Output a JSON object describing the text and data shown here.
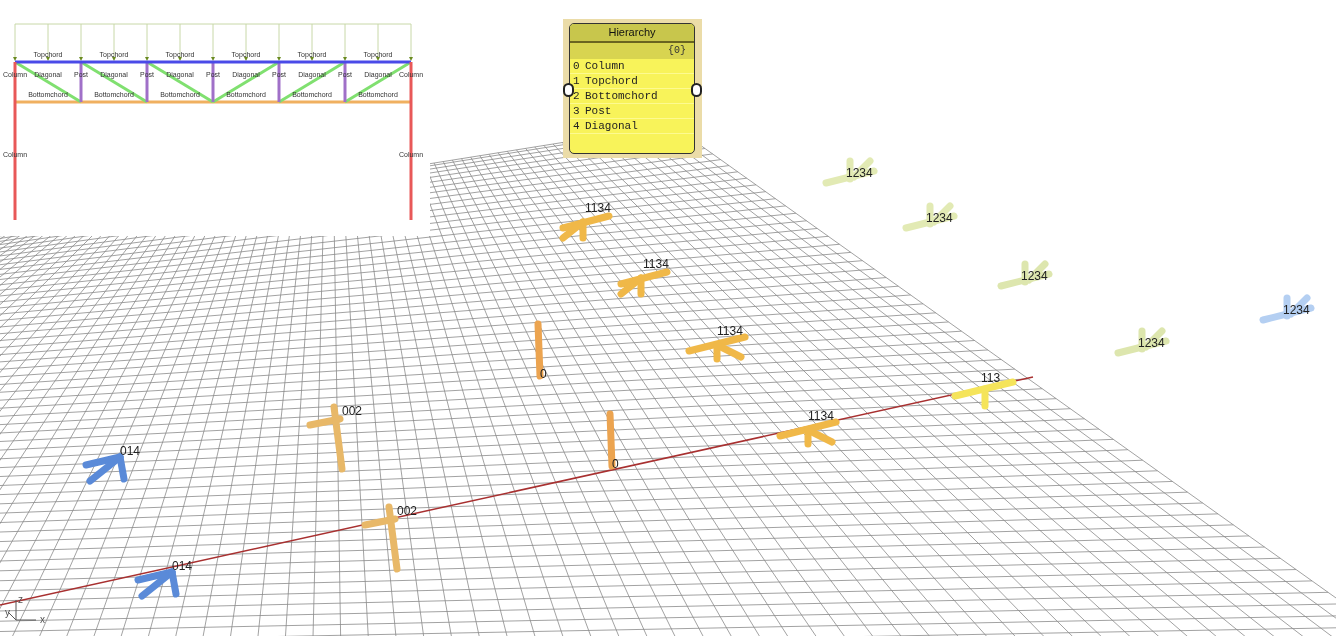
{
  "truss_diagram": {
    "bays": [
      {
        "top_label": "Topchord",
        "diagonal_label": "Diagonal",
        "bottom_label": "Bottomchord",
        "kind": "falling"
      },
      {
        "top_label": "Topchord",
        "diagonal_label": "Diagonal",
        "bottom_label": "Bottomchord",
        "kind": "falling"
      },
      {
        "top_label": "Topchord",
        "diagonal_label": "Diagonal",
        "bottom_label": "Bottomchord",
        "kind": "falling"
      },
      {
        "top_label": "Topchord",
        "diagonal_label": "Diagonal",
        "bottom_label": "Bottomchord",
        "kind": "rising"
      },
      {
        "top_label": "Topchord",
        "diagonal_label": "Diagonal",
        "bottom_label": "Bottomchord",
        "kind": "rising"
      },
      {
        "top_label": "Topchord",
        "diagonal_label": "Diagonal",
        "bottom_label": "Bottomchord",
        "kind": "rising"
      }
    ],
    "posts": [
      "Post",
      "Post",
      "Post",
      "Post",
      "Post"
    ],
    "columns": [
      {
        "upper_label": "Column",
        "lower_label": "Column"
      },
      {
        "upper_label": "Column",
        "lower_label": "Column"
      }
    ]
  },
  "hierarchy_panel": {
    "title": "Hierarchy",
    "path": "{0}",
    "items": [
      {
        "index": "0",
        "text": "Column"
      },
      {
        "index": "1",
        "text": "Topchord"
      },
      {
        "index": "2",
        "text": "Bottomchord"
      },
      {
        "index": "3",
        "text": "Post"
      },
      {
        "index": "4",
        "text": "Diagonal"
      }
    ]
  },
  "nodes": [
    {
      "label": "1134",
      "kind": "tee-brace",
      "color": "#f0b848"
    },
    {
      "label": "1134",
      "kind": "tee-brace",
      "color": "#f0b848"
    },
    {
      "label": "1134",
      "kind": "tee-back",
      "color": "#f0b848"
    },
    {
      "label": "1134",
      "kind": "tee-back",
      "color": "#f0b848"
    },
    {
      "label": "113",
      "kind": "tee",
      "color": "#f5e45a"
    },
    {
      "label": "1234",
      "kind": "tee-up",
      "color": "#e2eab4"
    },
    {
      "label": "1234",
      "kind": "tee-up",
      "color": "#e2eab4"
    },
    {
      "label": "1234",
      "kind": "tee-up",
      "color": "#dde6ae"
    },
    {
      "label": "1234",
      "kind": "tee-up",
      "color": "#dde6ae"
    },
    {
      "label": "1234",
      "kind": "tee-up",
      "color": "#b4cff2"
    },
    {
      "label": "0",
      "kind": "post",
      "color": "#eca450"
    },
    {
      "label": "0",
      "kind": "post",
      "color": "#eca450"
    },
    {
      "label": "002",
      "kind": "cross",
      "color": "#e8b868"
    },
    {
      "label": "002",
      "kind": "cross",
      "color": "#e8b868"
    },
    {
      "label": "014",
      "kind": "fork",
      "color": "#5a8ad8"
    },
    {
      "label": "014",
      "kind": "fork",
      "color": "#5a8ad8"
    }
  ],
  "axis_labels": [
    "z",
    "y",
    "x"
  ]
}
